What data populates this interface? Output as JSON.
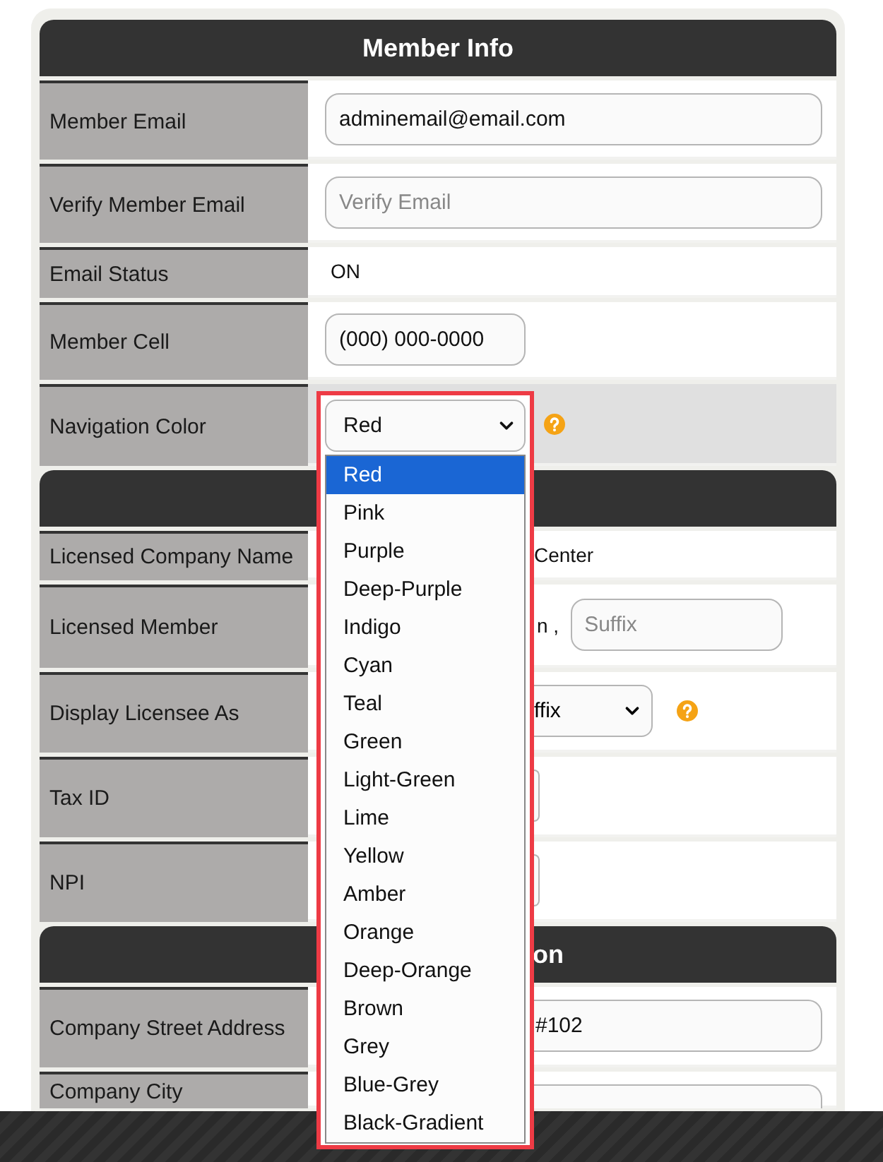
{
  "sections": [
    {
      "title": "Member Info",
      "rows": [
        {
          "label": "Member Email",
          "kind": "input",
          "value": "adminemail@email.com"
        },
        {
          "label": "Verify Member Email",
          "kind": "input",
          "placeholder": "Verify Email"
        },
        {
          "label": "Email Status",
          "kind": "text",
          "value": "ON"
        },
        {
          "label": "Member Cell",
          "kind": "short-input",
          "value": "(000) 000-0000"
        },
        {
          "label": "Navigation Color",
          "kind": "select",
          "value": "Red"
        }
      ]
    },
    {
      "rows": [
        {
          "label": "Licensed Company Name",
          "kind": "clipped-text",
          "value": "Center"
        },
        {
          "label": "Licensed Member",
          "kind": "clipped-input",
          "value": "n ,",
          "placeholder": "Suffix"
        },
        {
          "label": "Display Licensee As",
          "kind": "clipped-select",
          "value": "ffix"
        },
        {
          "label": "Tax ID",
          "kind": "field-edge"
        },
        {
          "label": "NPI",
          "kind": "field-edge"
        }
      ]
    },
    {
      "title": "on",
      "title_clipped": true,
      "rows": [
        {
          "label": "Company Street Address",
          "kind": "clipped-wide-input",
          "value": "#102"
        },
        {
          "label": "Company City",
          "kind": "clipped-wide-input"
        }
      ]
    }
  ],
  "dropdown": {
    "options": [
      {
        "label": "Red",
        "selected": true
      },
      {
        "label": "Pink",
        "selected": false
      },
      {
        "label": "Purple",
        "selected": false
      },
      {
        "label": "Deep-Purple",
        "selected": false
      },
      {
        "label": "Indigo",
        "selected": false
      },
      {
        "label": "Cyan",
        "selected": false
      },
      {
        "label": "Teal",
        "selected": false
      },
      {
        "label": "Green",
        "selected": false
      },
      {
        "label": "Light-Green",
        "selected": false
      },
      {
        "label": "Lime",
        "selected": false
      },
      {
        "label": "Yellow",
        "selected": false
      },
      {
        "label": "Amber",
        "selected": false
      },
      {
        "label": "Orange",
        "selected": false
      },
      {
        "label": "Deep-Orange",
        "selected": false
      },
      {
        "label": "Brown",
        "selected": false
      },
      {
        "label": "Grey",
        "selected": false
      },
      {
        "label": "Blue-Grey",
        "selected": false
      },
      {
        "label": "Black-Gradient",
        "selected": false
      }
    ]
  }
}
